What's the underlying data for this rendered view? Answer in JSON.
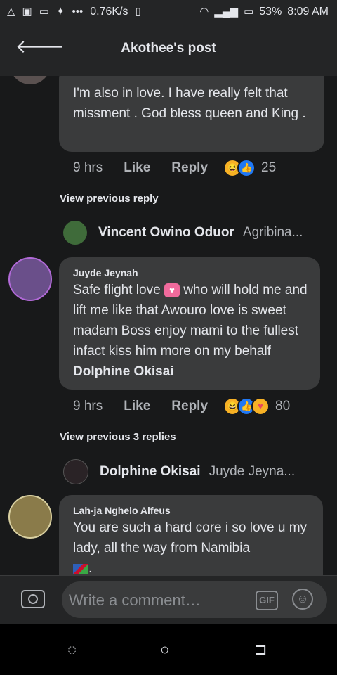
{
  "status_bar": {
    "left_icons": [
      "warning-icon",
      "gamepad-icon",
      "message-icon",
      "twitter-icon",
      "more-dots-icon"
    ],
    "speed": "0.76K/s",
    "battery": "53%",
    "time": "8:09 AM"
  },
  "header": {
    "title": "Akothee's post"
  },
  "comments": [
    {
      "text": "I'm also in love.  I have really felt that missment .  God bless queen and King .",
      "time": "9 hrs",
      "like": "Like",
      "reply": "Reply",
      "reaction_count": "25"
    },
    {
      "author": "Juyde Jeynah",
      "text_before": "Safe flight love",
      "text_after": " who will hold me and lift me like that Awouro love is sweet madam Boss enjoy mami to the fullest infact kiss him more on my behalf",
      "mention": "Dolphine Okisai",
      "time": "9 hrs",
      "like": "Like",
      "reply": "Reply",
      "reaction_count": "80"
    },
    {
      "author": "Lah-ja Nghelo Alfeus",
      "text": "You are such a hard core  i so love u my lady, all the way from Namibia",
      "text_end": "."
    }
  ],
  "view_previous": [
    "View previous reply",
    "View previous 3 replies"
  ],
  "replies": [
    {
      "name": "Vincent Owino Oduor",
      "snippet": "Agribina..."
    },
    {
      "name": "Dolphine Okisai",
      "snippet": "Juyde Jeyna..."
    }
  ],
  "composer": {
    "placeholder": "Write a comment…",
    "gif": "GIF"
  },
  "colors": {
    "background": "#18191a",
    "bubble": "#3a3b3c",
    "like_blue": "#2078f4",
    "haha_yellow": "#f7b125"
  }
}
